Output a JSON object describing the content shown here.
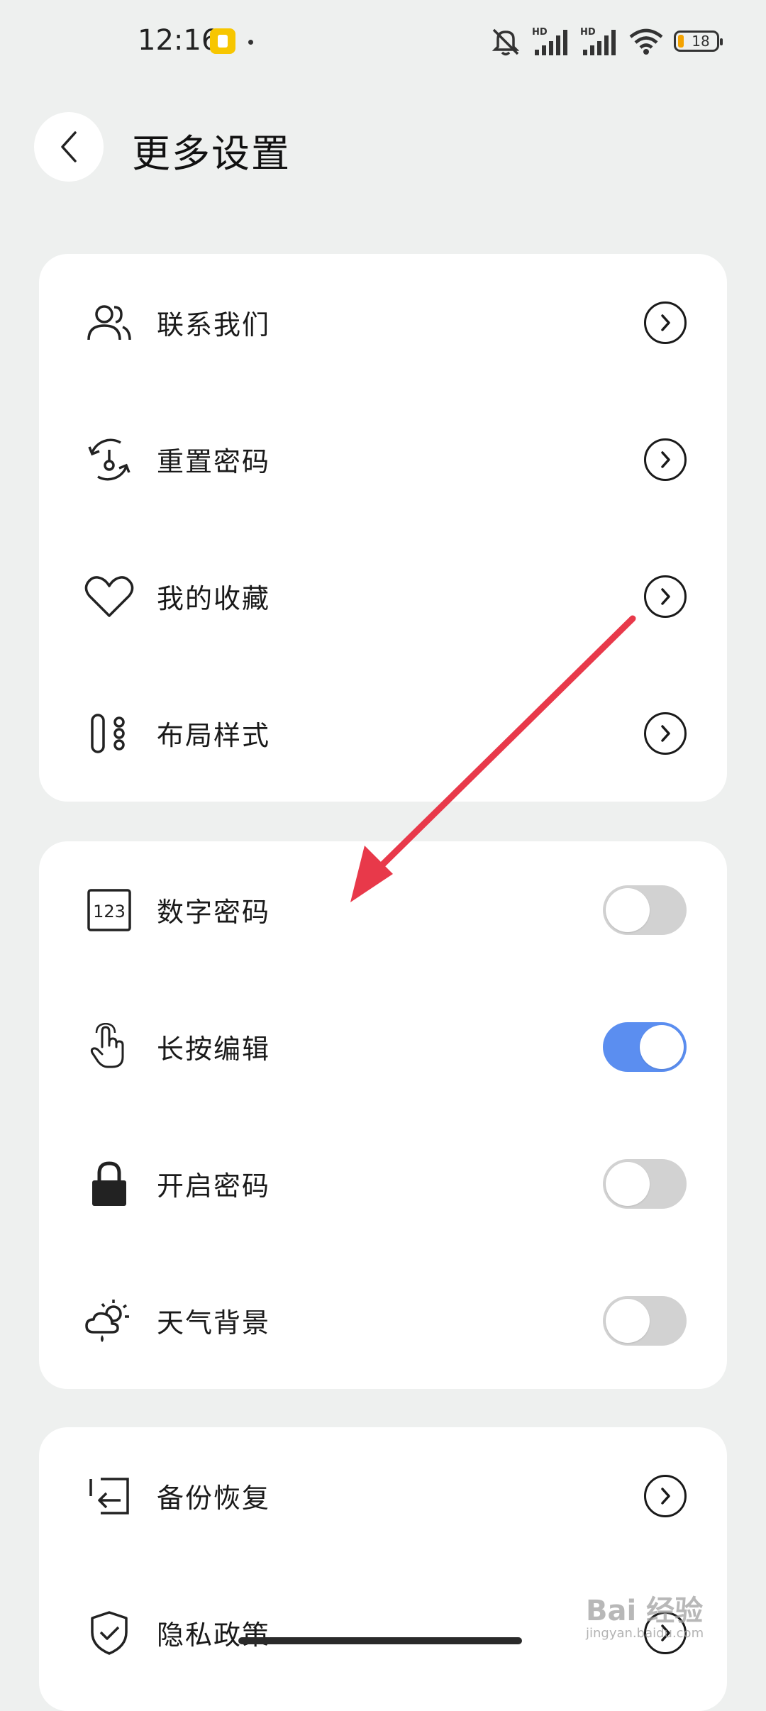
{
  "status_bar": {
    "time": "12:16",
    "battery_level": "18",
    "network_labels": [
      "HD",
      "HD"
    ]
  },
  "header": {
    "title": "更多设置"
  },
  "card1": {
    "items": [
      {
        "label": "联系我们",
        "icon": "contacts-icon"
      },
      {
        "label": "重置密码",
        "icon": "reset-password-icon"
      },
      {
        "label": "我的收藏",
        "icon": "heart-icon"
      },
      {
        "label": "布局样式",
        "icon": "layout-icon"
      }
    ]
  },
  "card2": {
    "items": [
      {
        "label": "数字密码",
        "icon": "number-password-icon",
        "enabled": false
      },
      {
        "label": "长按编辑",
        "icon": "long-press-icon",
        "enabled": true
      },
      {
        "label": "开启密码",
        "icon": "lock-icon",
        "enabled": false
      },
      {
        "label": "天气背景",
        "icon": "weather-icon",
        "enabled": false
      }
    ]
  },
  "card3": {
    "items": [
      {
        "label": "备份恢复",
        "icon": "backup-icon"
      },
      {
        "label": "隐私政策",
        "icon": "shield-icon"
      }
    ]
  },
  "watermark": {
    "brand": "Bai 经验",
    "url": "jingyan.baidu.com"
  },
  "colors": {
    "background": "#eef0ef",
    "card": "#ffffff",
    "toggle_on": "#5b8ef0",
    "toggle_off": "#d2d2d2",
    "arrow": "#e8394a"
  }
}
